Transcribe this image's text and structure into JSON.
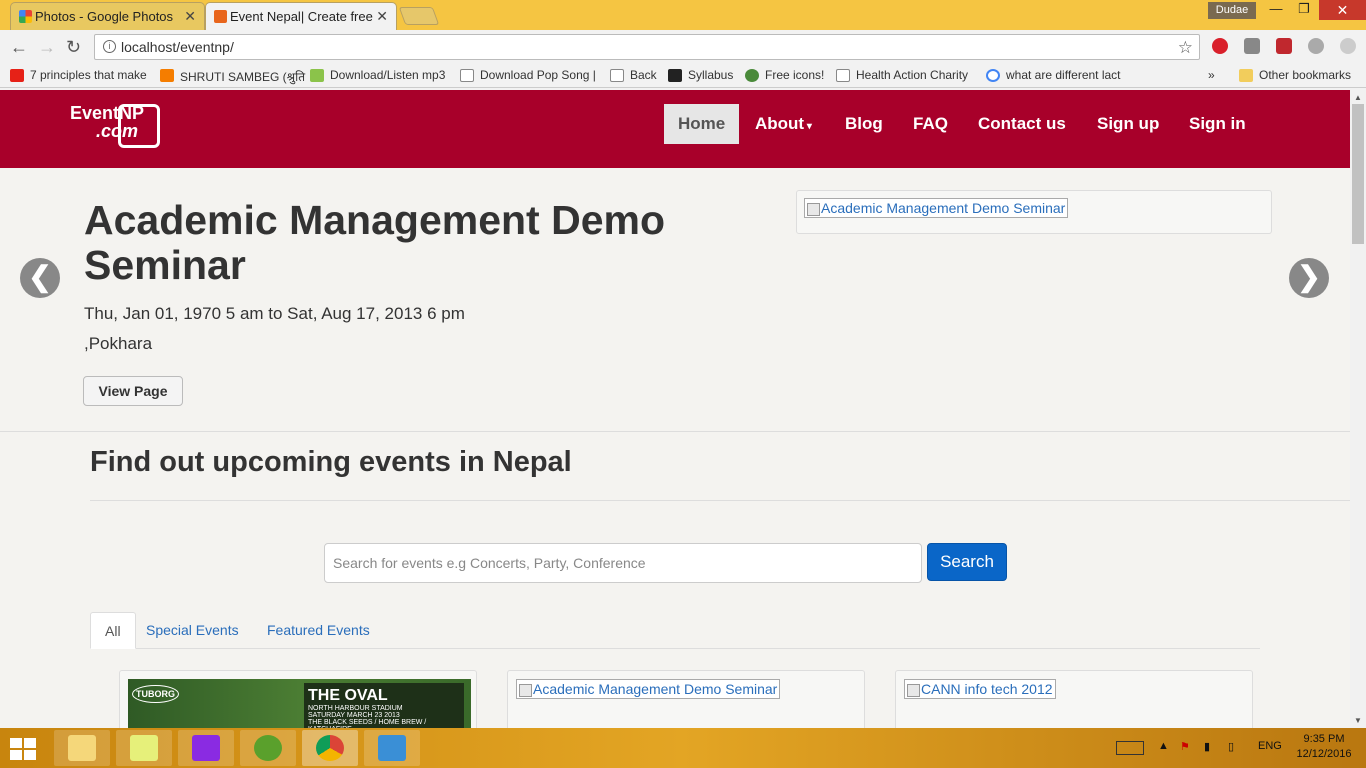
{
  "browser": {
    "tabs": [
      {
        "title": "Photos - Google Photos",
        "close": "✕"
      },
      {
        "title": "Event Nepal| Create free",
        "close": "✕"
      }
    ],
    "profile": "Dudae",
    "url": "localhost/eventnp/",
    "bookmarks": [
      "7 principles that make",
      "SHRUTI SAMBEG (श्रुति",
      "Download/Listen mp3",
      "Download Pop Song |",
      "Back",
      "Syllabus",
      "Free icons!",
      "Health Action Charity",
      "what are different lact"
    ],
    "bookmarks_overflow": "»",
    "other_bookmarks": "Other bookmarks"
  },
  "site": {
    "logo_line1": "EventNP",
    "logo_line2": ".com",
    "nav": [
      "Home",
      "About",
      "Blog",
      "FAQ",
      "Contact us",
      "Sign up",
      "Sign in"
    ],
    "active_nav": "Home",
    "hero": {
      "title": "Academic Management Demo Seminar",
      "date": "Thu, Jan 01, 1970 5 am to Sat, Aug 17, 2013 6 pm",
      "location": ",Pokhara",
      "button": "View Page",
      "image_alt": "Academic Management Demo Seminar",
      "prev": "❮",
      "next": "❯"
    },
    "section_title": "Find out upcoming events in Nepal",
    "search": {
      "placeholder": "Search for events e.g Concerts, Party, Conference",
      "button": "Search"
    },
    "tabs": [
      "All",
      "Special Events",
      "Featured Events"
    ],
    "cards": [
      {
        "poster_brand": "TUBORG",
        "poster_title": "THE OVAL",
        "poster_sub": "NORTH HARBOUR STADIUM",
        "poster_date": "SATURDAY MARCH 23 2013",
        "poster_bands": "THE BLACK SEEDS / HOME BREW / KATCHAFIRE"
      },
      {
        "image_alt": "Academic Management Demo Seminar"
      },
      {
        "image_alt": "CANN info tech 2012"
      }
    ]
  },
  "taskbar": {
    "lang": "ENG",
    "time": "9:35 PM",
    "date": "12/12/2016"
  }
}
